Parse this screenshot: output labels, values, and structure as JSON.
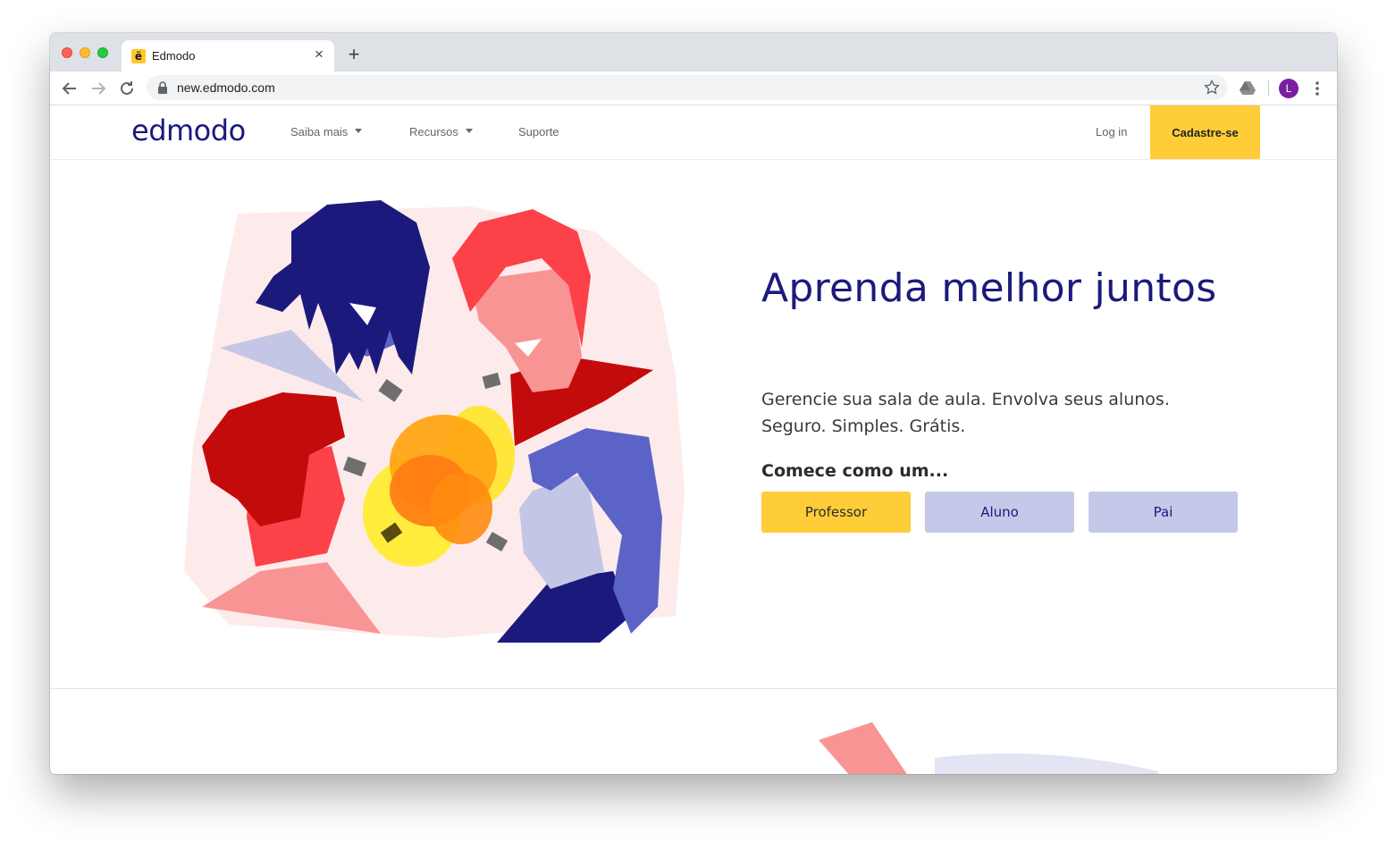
{
  "browser": {
    "tab": {
      "title": "Edmodo",
      "favicon": "ë",
      "close_icon": "close-icon"
    },
    "new_tab_icon": "+",
    "url": "new.edmodo.com",
    "profile_initial": "L",
    "profile_color": "#7b1fa2"
  },
  "header": {
    "logo": "edmodo",
    "nav": [
      {
        "label": "Saiba mais",
        "has_dropdown": true
      },
      {
        "label": "Recursos",
        "has_dropdown": true
      },
      {
        "label": "Suporte",
        "has_dropdown": false
      }
    ],
    "login_label": "Log in",
    "signup_label": "Cadastre-se"
  },
  "hero": {
    "title": "Aprenda melhor juntos",
    "subtitle_line1": "Gerencie sua sala de aula. Envolva seus alunos.",
    "subtitle_line2": "Seguro. Simples. Grátis.",
    "start_as": "Comece como um...",
    "roles": [
      "Professor",
      "Aluno",
      "Pai"
    ]
  },
  "colors": {
    "brand_navy": "#1b1a7c",
    "cta_yellow": "#ffcd37",
    "role_lavender": "#c5c8e8"
  }
}
